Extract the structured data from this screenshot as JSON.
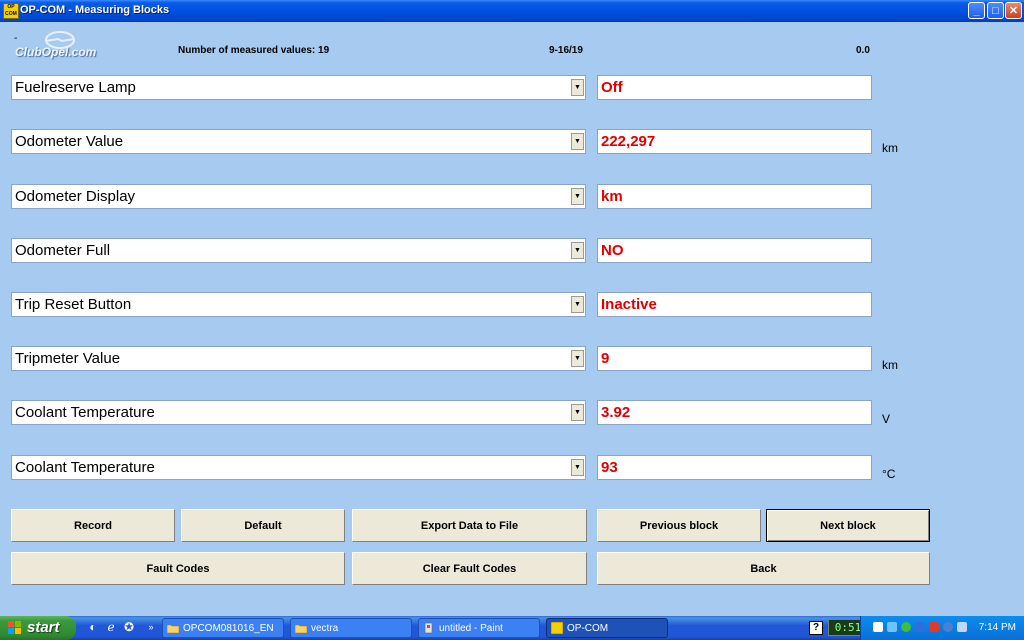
{
  "window": {
    "title": "OP-COM - Measuring Blocks",
    "app_icon_text": "OP COM"
  },
  "logo": {
    "text": "ClubOpel.com"
  },
  "info": {
    "dash": "-",
    "count": "Number of measured values: 19",
    "range": "9-16/19",
    "value": "0.0"
  },
  "rows": [
    {
      "label": "Fuelreserve Lamp",
      "value": "Off",
      "unit": ""
    },
    {
      "label": "Odometer Value",
      "value": "222,297",
      "unit": "km"
    },
    {
      "label": "Odometer Display",
      "value": "km",
      "unit": ""
    },
    {
      "label": "Odometer Full",
      "value": "NO",
      "unit": ""
    },
    {
      "label": "Trip Reset Button",
      "value": "Inactive",
      "unit": ""
    },
    {
      "label": "Tripmeter Value",
      "value": "9",
      "unit": "km"
    },
    {
      "label": "Coolant Temperature",
      "value": "3.92",
      "unit": "V"
    },
    {
      "label": "Coolant Temperature",
      "value": "93",
      "unit": "°C"
    }
  ],
  "buttons": {
    "record": "Record",
    "default": "Default",
    "export": "Export Data to File",
    "previous": "Previous block",
    "next": "Next block",
    "fault_codes": "Fault Codes",
    "clear_fault_codes": "Clear Fault Codes",
    "back": "Back"
  },
  "taskbar": {
    "start": "start",
    "tasks": [
      {
        "label": "OPCOM081016_EN"
      },
      {
        "label": "vectra"
      },
      {
        "label": "untitled - Paint"
      },
      {
        "label": "OP-COM"
      }
    ],
    "meter": "0:51",
    "clock": "7:14 PM",
    "help": "?"
  },
  "colors": {
    "background": "#a6caf0",
    "value_text": "#e00000",
    "titlebar": "#0050e0"
  }
}
